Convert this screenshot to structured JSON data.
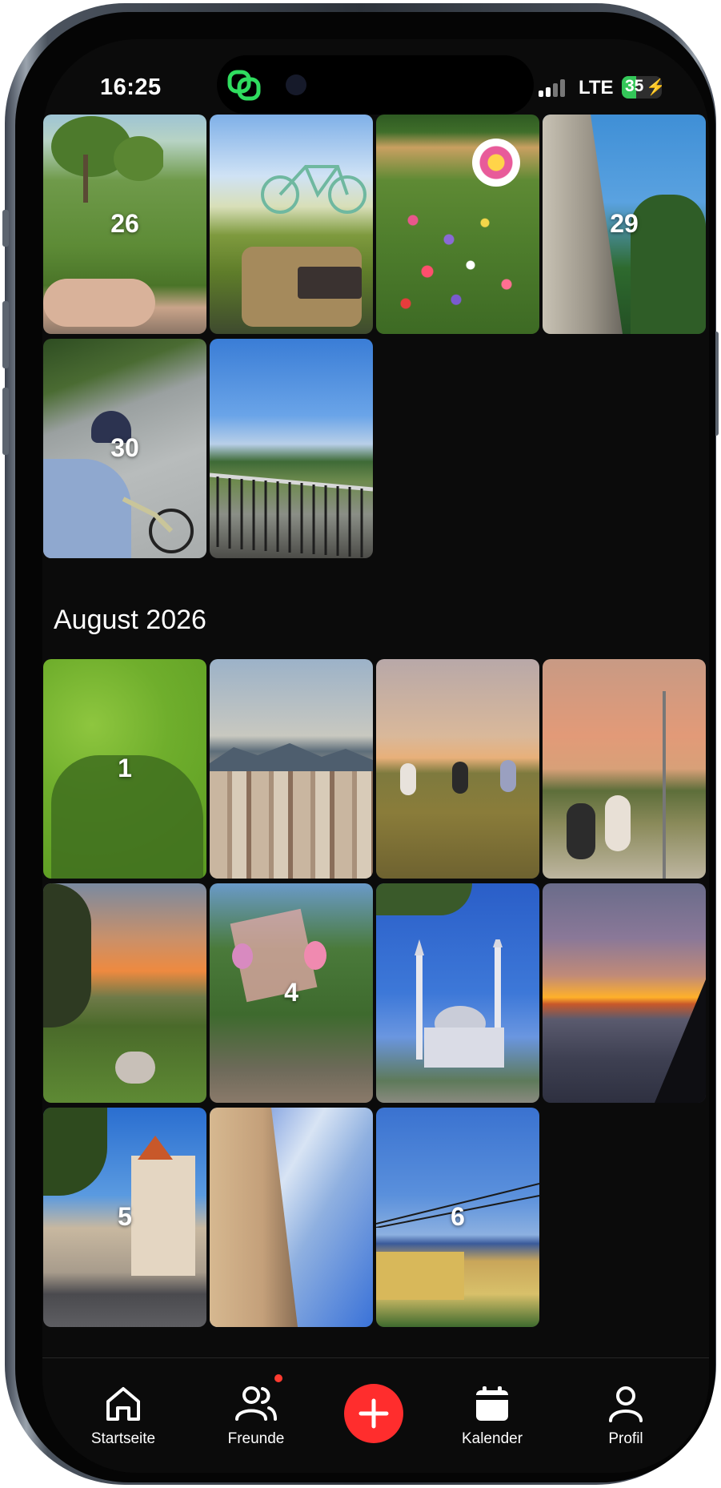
{
  "status": {
    "time": "16:25",
    "network": "LTE",
    "battery": "35",
    "battery_level": 0.35
  },
  "feed": {
    "month_heading": "August 2026",
    "days": [
      {
        "label": "26",
        "id": "t26"
      },
      {
        "label": "",
        "id": "t27"
      },
      {
        "label": "",
        "id": "t28"
      },
      {
        "label": "29",
        "id": "t29"
      },
      {
        "label": "30",
        "id": "t30"
      },
      {
        "label": "",
        "id": "t31"
      },
      {
        "label": "1",
        "id": "a1"
      },
      {
        "label": "",
        "id": "a2"
      },
      {
        "label": "",
        "id": "a3"
      },
      {
        "label": "",
        "id": "a4b"
      },
      {
        "label": "",
        "id": "a5b"
      },
      {
        "label": "4",
        "id": "a4"
      },
      {
        "label": "",
        "id": "a7"
      },
      {
        "label": "",
        "id": "a8"
      },
      {
        "label": "5",
        "id": "a5"
      },
      {
        "label": "",
        "id": "a10"
      },
      {
        "label": "6",
        "id": "a6"
      }
    ]
  },
  "tabbar": {
    "home": "Startseite",
    "friends": "Freunde",
    "calendar": "Kalender",
    "profile": "Profil"
  },
  "icons": {
    "home": "home-icon",
    "friends": "friends-icon",
    "add": "plus-icon",
    "calendar": "calendar-icon",
    "profile": "profile-icon"
  },
  "colors": {
    "accent": "#ff2d2d",
    "badge": "#ff3b30",
    "battery": "#34c759",
    "background": "#0b0b0b"
  }
}
